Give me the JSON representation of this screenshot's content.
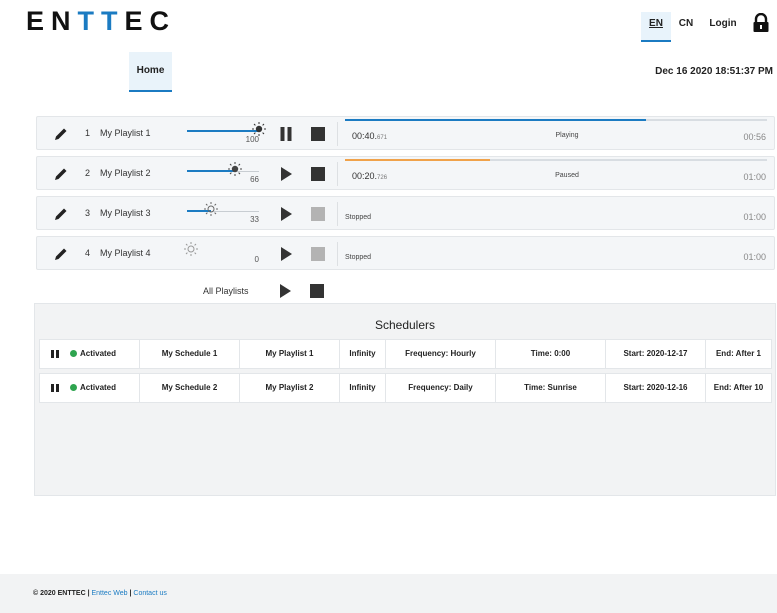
{
  "header": {
    "logo_pre": "EN",
    "logo_tt": "TT",
    "logo_post": "EC",
    "lang_en": "EN",
    "lang_cn": "CN",
    "login": "Login",
    "lock_icon": "lock-icon",
    "accent_color": "#1b7bc2"
  },
  "nav": {
    "home": "Home"
  },
  "clock": "Dec 16 2020 18:51:37 PM",
  "playlists": [
    {
      "num": "1",
      "name": "My Playlist 1",
      "volume": "100",
      "volume_level": 100,
      "state": "playing",
      "elapsed": "00:40.",
      "elapsed_ms": "671",
      "status": "Playing",
      "progress": 0.714,
      "progress_color": "#1b7bc2",
      "duration": "00:56"
    },
    {
      "num": "2",
      "name": "My Playlist 2",
      "volume": "66",
      "volume_level": 66,
      "state": "paused",
      "elapsed": "00:20.",
      "elapsed_ms": "726",
      "status": "Paused",
      "progress": 0.344,
      "progress_color": "#f0a24a",
      "duration": "01:00"
    },
    {
      "num": "3",
      "name": "My Playlist 3",
      "volume": "33",
      "volume_level": 33,
      "state": "stopped",
      "status": "Stopped",
      "duration": "01:00"
    },
    {
      "num": "4",
      "name": "My Playlist 4",
      "volume": "0",
      "volume_level": 0,
      "state": "stopped",
      "status": "Stopped",
      "duration": "01:00"
    }
  ],
  "all_playlists": "All Playlists",
  "schedulers": {
    "title": "Schedulers",
    "rows": [
      {
        "status": "Activated",
        "name": "My Schedule 1",
        "playlist": "My Playlist 1",
        "repeat": "Infinity",
        "frequency": "Frequency: Hourly",
        "time": "Time: 0:00",
        "start": "Start: 2020-12-17",
        "end": "End: After 1"
      },
      {
        "status": "Activated",
        "name": "My Schedule 2",
        "playlist": "My Playlist 2",
        "repeat": "Infinity",
        "frequency": "Frequency: Daily",
        "time": "Time: Sunrise",
        "start": "Start: 2020-12-16",
        "end": "End: After 10"
      }
    ]
  },
  "footer": {
    "copyright": "© 2020 ENTTEC | ",
    "link1": "Enttec Web",
    "sep": " | ",
    "link2": "Contact us"
  }
}
